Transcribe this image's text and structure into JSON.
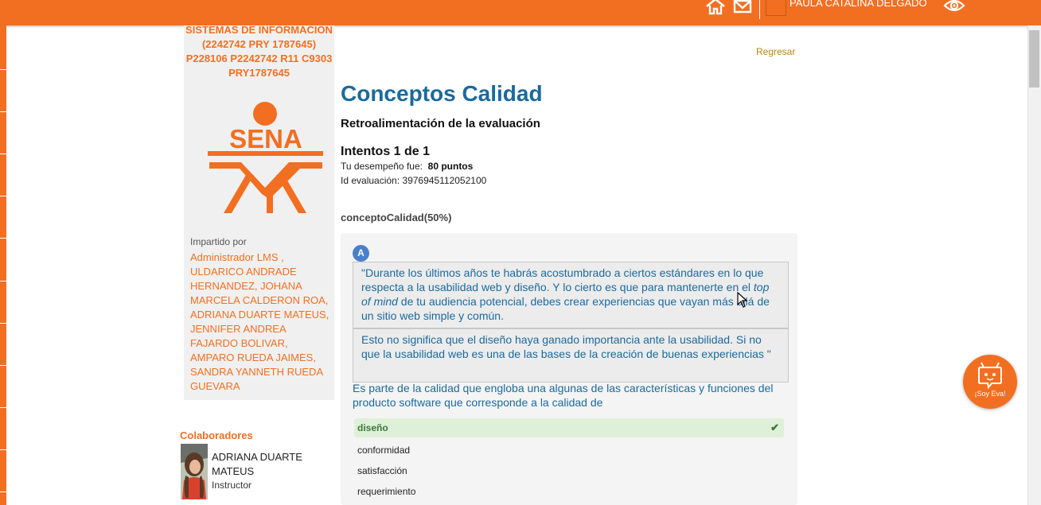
{
  "header": {
    "user_name": "PAULA CATALINA DELGADO",
    "icons": [
      "home-icon",
      "mail-icon",
      "eye-icon"
    ]
  },
  "sidebar": {
    "course_title": "SISTEMAS DE INFORMACION (2242742 PRY 1787645) P228106 P2242742 R11 C9303 PRY1787645",
    "logo_text": "SENA",
    "impartido_label": "Impartido por",
    "instructors": "Administrador LMS , ULDARICO ANDRADE HERNANDEZ, JOHANA MARCELA CALDERON ROA, ADRIANA DUARTE MATEUS, JENNIFER ANDREA FAJARDO BOLIVAR, AMPARO RUEDA JAIMES, SANDRA YANNETH RUEDA GUEVARA",
    "collaborators_title": "Colaboradores",
    "collaborator": {
      "name": "ADRIANA DUARTE MATEUS",
      "role": "Instructor"
    }
  },
  "main": {
    "back_link": "Regresar",
    "title": "Conceptos Calidad",
    "subtitle": "Retroalimentación de la evaluación",
    "attempts": "Intentos 1 de 1",
    "performance_label": "Tu desempeño fue:",
    "performance_value": "80 puntos",
    "eval_id_label": "Id evaluación:",
    "eval_id_value": "3976945112052100",
    "section_title": "conceptoCalidad(50%)",
    "question": {
      "badge": "A",
      "quote_part1_a": "\"Durante los últimos años te habrás acostumbrado a ciertos estándares en lo que respecta a la usabilidad web y diseño. Y lo cierto es que para mantenerte en el ",
      "quote_part1_em": "top of mind",
      "quote_part1_b": " de tu audiencia potencial, debes crear experiencias que vayan más allá de un sitio web simple y común.",
      "quote_part2": "Esto no significa que el diseño haya ganado importancia ante la usabilidad. Si no que la usabilidad web es una de las bases de la creación de buenas experiencias \"",
      "prompt": "Es parte de la calidad que engloba una algunas de las características y funciones del producto software que corresponde a la calidad de",
      "options": [
        {
          "label": "diseño",
          "correct": true
        },
        {
          "label": "conformidad",
          "correct": false
        },
        {
          "label": "satisfacción",
          "correct": false
        },
        {
          "label": "requerimiento",
          "correct": false
        }
      ],
      "correct_mark": "✔"
    }
  },
  "assistant": {
    "label": "¡Soy Eva!"
  },
  "colors": {
    "brand_orange": "#f26f21",
    "title_blue": "#1b6a9c",
    "correct_green": "#dff0d8"
  }
}
